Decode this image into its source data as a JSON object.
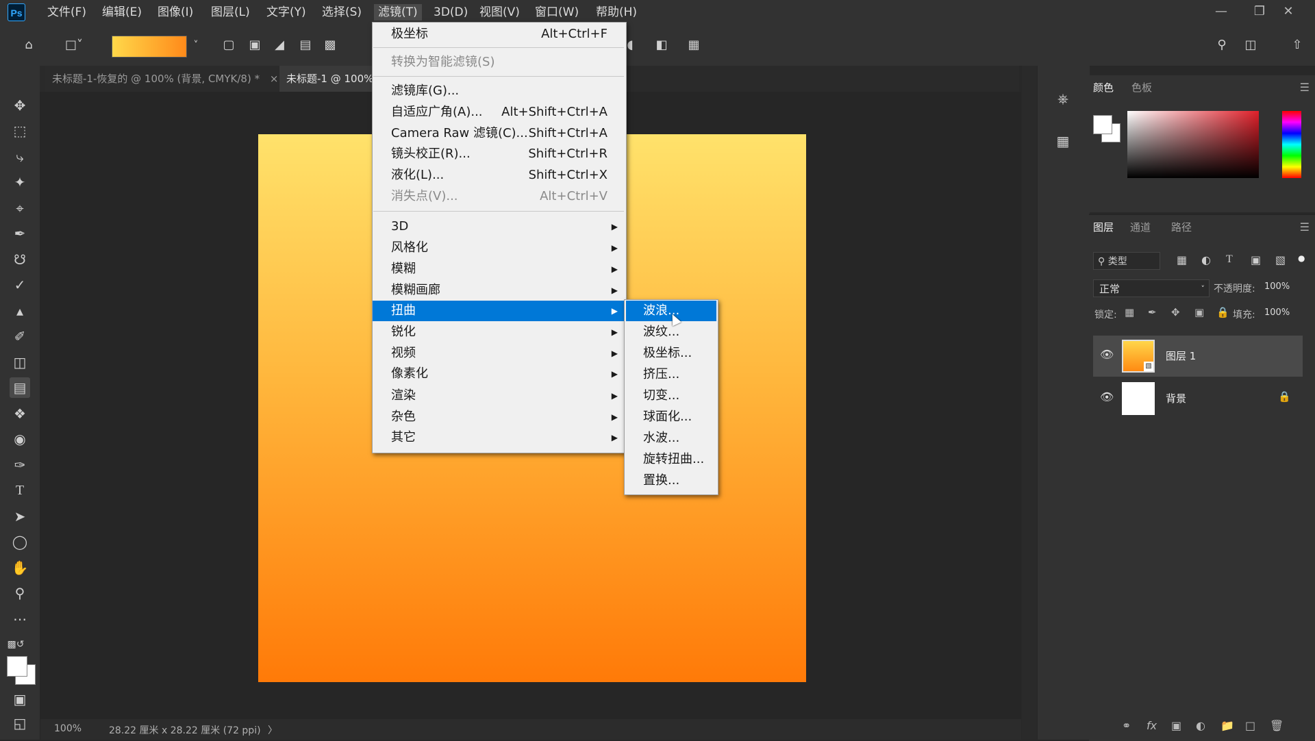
{
  "app": {
    "logo": "Ps"
  },
  "menubar": {
    "items": [
      "文件(F)",
      "编辑(E)",
      "图像(I)",
      "图层(L)",
      "文字(Y)",
      "选择(S)",
      "滤镜(T)",
      "3D(D)",
      "视图(V)",
      "窗口(W)",
      "帮助(H)"
    ],
    "active_index": 6,
    "window_controls": [
      "minimize-icon",
      "restore-icon",
      "close-icon"
    ]
  },
  "optionsbar": {
    "icons": [
      "home-icon",
      "gradient-tool-preset-icon",
      "gradient-swatch",
      "linear-gradient-icon",
      "radial-gradient-icon",
      "angle-gradient-icon",
      "reflected-gradient-icon",
      "diamond-gradient-icon",
      "dither-icon",
      "transparency-icon",
      "search-icon",
      "workspace-icon",
      "share-icon"
    ],
    "gradient_colors": [
      "#ffd84a",
      "#ff8a1a"
    ]
  },
  "tabs": [
    {
      "label": "未标题-1-恢复的 @ 100% (背景, CMYK/8) *",
      "close": "×",
      "active": false
    },
    {
      "label": "未标题-1 @ 100%",
      "close": "",
      "active": true
    }
  ],
  "toolbar": {
    "tools": [
      "move-tool-icon",
      "marquee-tool-icon",
      "lasso-tool-icon",
      "magic-wand-icon",
      "crop-tool-icon",
      "eyedropper-icon",
      "healing-brush-icon",
      "brush-tool-icon",
      "clone-stamp-icon",
      "history-brush-icon",
      "eraser-icon",
      "gradient-tool-icon",
      "blur-tool-icon",
      "dodge-tool-icon",
      "pen-tool-icon",
      "type-tool-icon",
      "path-select-icon",
      "ellipse-tool-icon",
      "hand-tool-icon",
      "zoom-tool-icon",
      "more-tools-icon"
    ],
    "fg_color": "#ffffff",
    "bg_color": "#ffffff"
  },
  "canvas": {
    "gradient_top": "#ffe26b",
    "gradient_bottom": "#ff7a08"
  },
  "status": {
    "zoom": "100%",
    "doc_info": "28.22 厘米 x 28.22 厘米 (72 ppi)",
    "arrow": "〉"
  },
  "filter_menu": {
    "items": [
      {
        "label": "极坐标",
        "shortcut": "Alt+Ctrl+F",
        "disabled": false
      },
      {
        "label": "转换为智能滤镜(S)",
        "shortcut": "",
        "disabled": true
      },
      {
        "label": "滤镜库(G)...",
        "shortcut": "",
        "disabled": false
      },
      {
        "label": "自适应广角(A)...",
        "shortcut": "Alt+Shift+Ctrl+A",
        "disabled": false
      },
      {
        "label": "Camera Raw 滤镜(C)...",
        "shortcut": "Shift+Ctrl+A",
        "disabled": false
      },
      {
        "label": "镜头校正(R)...",
        "shortcut": "Shift+Ctrl+R",
        "disabled": false
      },
      {
        "label": "液化(L)...",
        "shortcut": "Shift+Ctrl+X",
        "disabled": false
      },
      {
        "label": "消失点(V)...",
        "shortcut": "Alt+Ctrl+V",
        "disabled": true
      },
      {
        "label": "3D",
        "submenu": true
      },
      {
        "label": "风格化",
        "submenu": true
      },
      {
        "label": "模糊",
        "submenu": true
      },
      {
        "label": "模糊画廊",
        "submenu": true
      },
      {
        "label": "扭曲",
        "submenu": true,
        "highlighted": true
      },
      {
        "label": "锐化",
        "submenu": true
      },
      {
        "label": "视频",
        "submenu": true
      },
      {
        "label": "像素化",
        "submenu": true
      },
      {
        "label": "渲染",
        "submenu": true
      },
      {
        "label": "杂色",
        "submenu": true
      },
      {
        "label": "其它",
        "submenu": true
      }
    ],
    "submenu_arrow": "▶"
  },
  "distort_submenu": {
    "items": [
      "波浪...",
      "波纹...",
      "极坐标...",
      "挤压...",
      "切变...",
      "球面化...",
      "水波...",
      "旋转扭曲...",
      "置换..."
    ],
    "highlighted_index": 0
  },
  "color_panel": {
    "tabs": [
      "颜色",
      "色板"
    ],
    "fg": "#ffffff",
    "bg": "#ffffff",
    "field_hue": "#e0202a"
  },
  "layers_panel": {
    "tabs": [
      "图层",
      "通道",
      "路径"
    ],
    "filter_label": "类型",
    "blend_mode": "正常",
    "opacity_label": "不透明度:",
    "opacity": "100%",
    "lock_label": "锁定:",
    "fill_label": "填充:",
    "fill": "100%",
    "layers": [
      {
        "name": "图层 1",
        "thumb": "orange",
        "selected": true,
        "locked": false
      },
      {
        "name": "背景",
        "thumb": "white",
        "selected": false,
        "locked": true
      }
    ],
    "footer_icons": [
      "link-icon",
      "fx-icon",
      "mask-icon",
      "adjustment-icon",
      "group-icon",
      "new-layer-icon",
      "trash-icon"
    ]
  }
}
